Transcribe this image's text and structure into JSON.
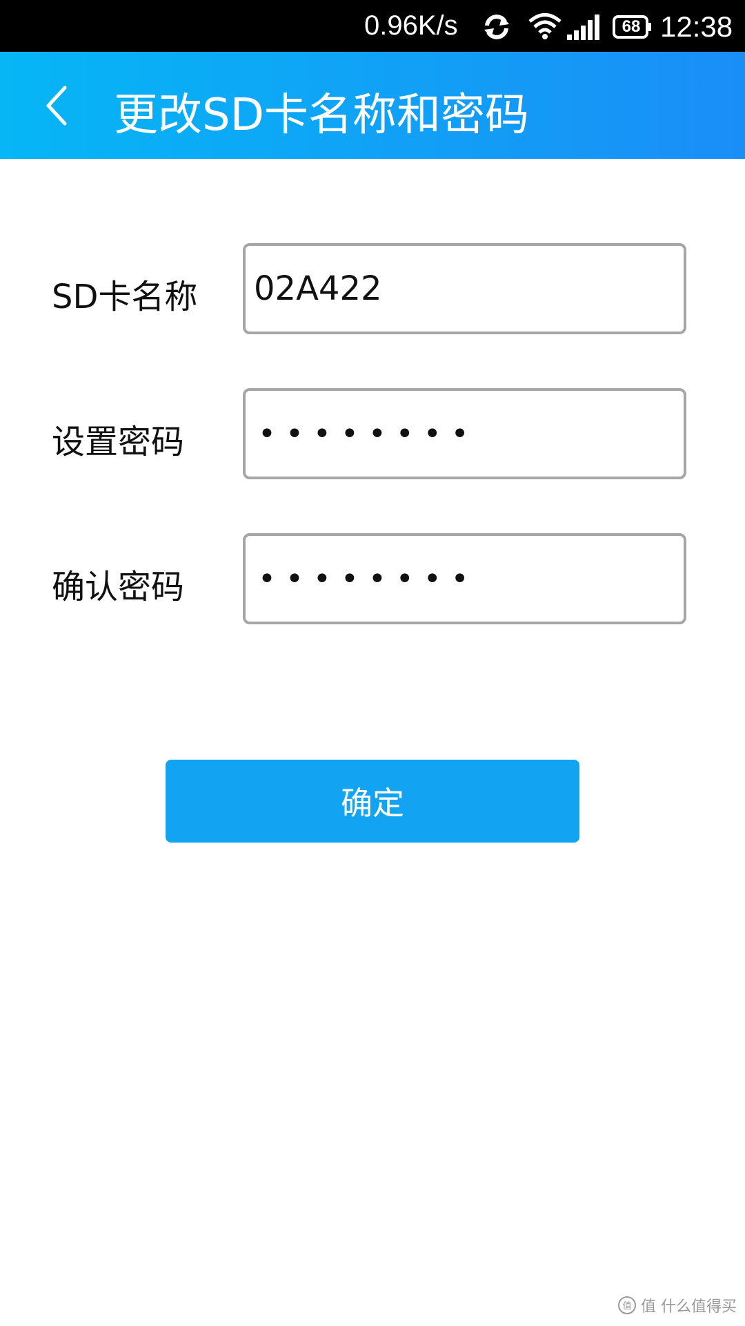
{
  "status_bar": {
    "speed": "0.96K/s",
    "battery_level": "68",
    "time": "12:38",
    "icons": [
      "sync-icon",
      "wifi-icon",
      "signal-icon",
      "battery-icon"
    ]
  },
  "header": {
    "title": "更改SD卡名称和密码",
    "back_icon": "chevron-left-icon",
    "accent_start": "#06b6f5",
    "accent_end": "#1a8ef7"
  },
  "form": {
    "sd_name": {
      "label": "SD卡名称",
      "value": "02A422"
    },
    "set_password": {
      "label": "设置密码",
      "value": "••••••••"
    },
    "confirm_password": {
      "label": "确认密码",
      "value": "••••••••"
    }
  },
  "confirm_button": {
    "label": "确定",
    "color": "#12a4f3"
  },
  "watermark": {
    "text": "值 什么值得买"
  }
}
